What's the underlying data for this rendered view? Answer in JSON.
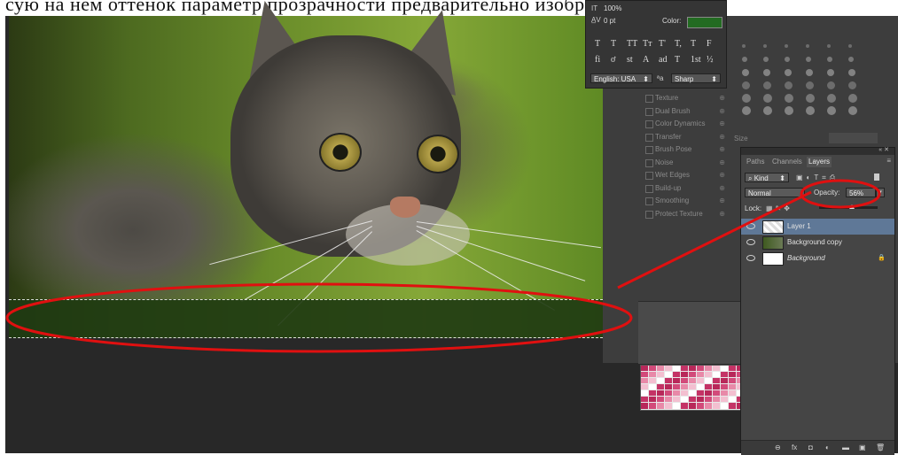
{
  "top_strip_text": "сую на нем оттенок параметр прозрачности предварительно изображения",
  "character_panel": {
    "leading_value": "100%",
    "tracking_value": "0 pt",
    "color_label": "Color:",
    "color_hex": "#236b22",
    "typo_glyphs": [
      "T",
      "T",
      "TT",
      "Tт",
      "T'",
      "T,",
      "T",
      "F"
    ],
    "opentype_glyphs": [
      "fi",
      "ơ",
      "st",
      "A",
      "ad",
      "T",
      "1st",
      "½"
    ],
    "language": "English: USA",
    "aa_label": "a",
    "aa_value": "Sharp"
  },
  "brush_options": [
    {
      "label": "Texture"
    },
    {
      "label": "Dual Brush"
    },
    {
      "label": "Color Dynamics"
    },
    {
      "label": "Transfer"
    },
    {
      "label": "Brush Pose"
    },
    {
      "label": "Noise"
    },
    {
      "label": "Wet Edges"
    },
    {
      "label": "Build-up"
    },
    {
      "label": "Smoothing"
    },
    {
      "label": "Protect Texture"
    }
  ],
  "brush_size_label": "Size",
  "layers_panel": {
    "tabs": [
      "Paths",
      "Channels",
      "Layers"
    ],
    "active_tab": "Layers",
    "filter_kind": "Kind",
    "blend_mode": "Normal",
    "opacity_label": "Opacity:",
    "opacity_value": "56%",
    "lock_label": "Lock:",
    "layers": [
      {
        "name": "Layer 1",
        "selected": true
      },
      {
        "name": "Background copy",
        "selected": false
      },
      {
        "name": "Background",
        "selected": false,
        "italic": true,
        "locked": true
      }
    ],
    "footer_icons": [
      "link-icon",
      "fx-icon",
      "mask-icon",
      "adjustment-icon",
      "folder-icon",
      "new-layer-icon",
      "trash-icon"
    ]
  },
  "colors": {
    "annotation_red": "#e01010",
    "selected_layer": "#5f7897",
    "panel_bg": "#454545"
  }
}
